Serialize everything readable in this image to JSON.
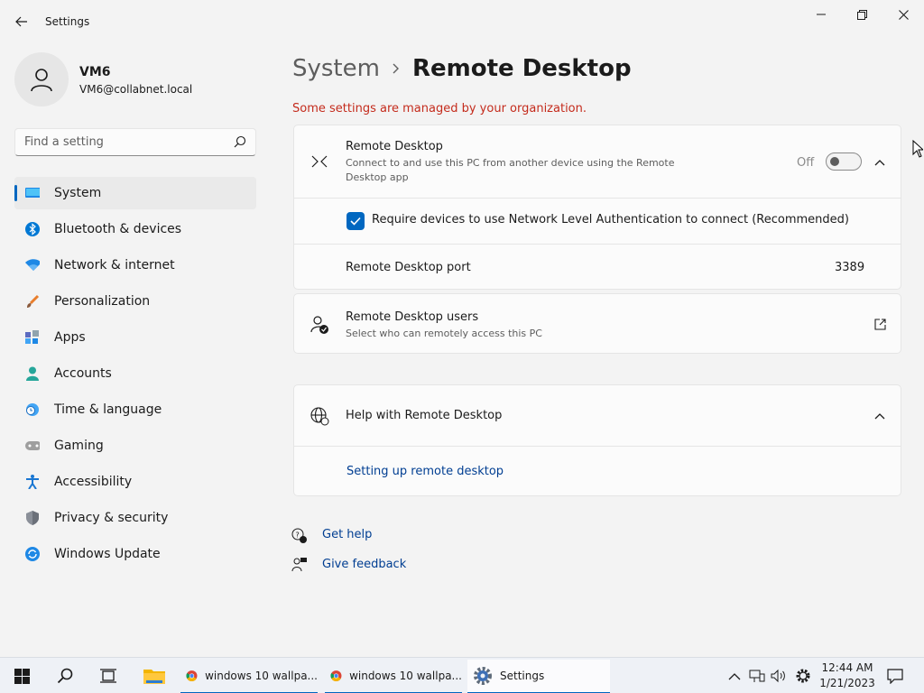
{
  "window": {
    "title": "Settings",
    "back_icon": "arrow-left-icon",
    "controls": {
      "minimize": "minimize-icon",
      "maximize": "restore-icon",
      "close": "close-icon"
    }
  },
  "profile": {
    "name": "VM6",
    "email": "VM6@collabnet.local"
  },
  "search": {
    "placeholder": "Find a setting",
    "value": ""
  },
  "sidebar": {
    "items": [
      {
        "label": "System",
        "icon": "monitor-icon",
        "active": true
      },
      {
        "label": "Bluetooth & devices",
        "icon": "bluetooth-icon"
      },
      {
        "label": "Network & internet",
        "icon": "wifi-icon"
      },
      {
        "label": "Personalization",
        "icon": "brush-icon"
      },
      {
        "label": "Apps",
        "icon": "apps-icon"
      },
      {
        "label": "Accounts",
        "icon": "person-icon"
      },
      {
        "label": "Time & language",
        "icon": "clock-globe-icon"
      },
      {
        "label": "Gaming",
        "icon": "gamepad-icon"
      },
      {
        "label": "Accessibility",
        "icon": "accessibility-icon"
      },
      {
        "label": "Privacy & security",
        "icon": "shield-icon"
      },
      {
        "label": "Windows Update",
        "icon": "update-icon"
      }
    ]
  },
  "main": {
    "breadcrumb_parent": "System",
    "breadcrumb_current": "Remote Desktop",
    "managed_notice": "Some settings are managed by your organization.",
    "remote_desktop": {
      "title": "Remote Desktop",
      "description": "Connect to and use this PC from another device using the Remote Desktop app",
      "toggle_state": "Off",
      "nla_label": "Require devices to use Network Level Authentication to connect (Recommended)",
      "nla_checked": true,
      "port_label": "Remote Desktop port",
      "port_value": "3389"
    },
    "users": {
      "title": "Remote Desktop users",
      "description": "Select who can remotely access this PC"
    },
    "help": {
      "title": "Help with Remote Desktop",
      "link": "Setting up remote desktop"
    },
    "get_help": "Get help",
    "give_feedback": "Give feedback"
  },
  "taskbar": {
    "apps": [
      {
        "label": "windows 10 wallpa...",
        "icon": "chrome-icon"
      },
      {
        "label": "windows 10 wallpa...",
        "icon": "chrome-icon"
      },
      {
        "label": "Settings",
        "icon": "settings-gear-icon",
        "active": true
      }
    ],
    "time": "12:44 AM",
    "date": "1/21/2023"
  },
  "colors": {
    "accent": "#0067c0",
    "warning": "#c42b1c",
    "link": "#003e92"
  }
}
